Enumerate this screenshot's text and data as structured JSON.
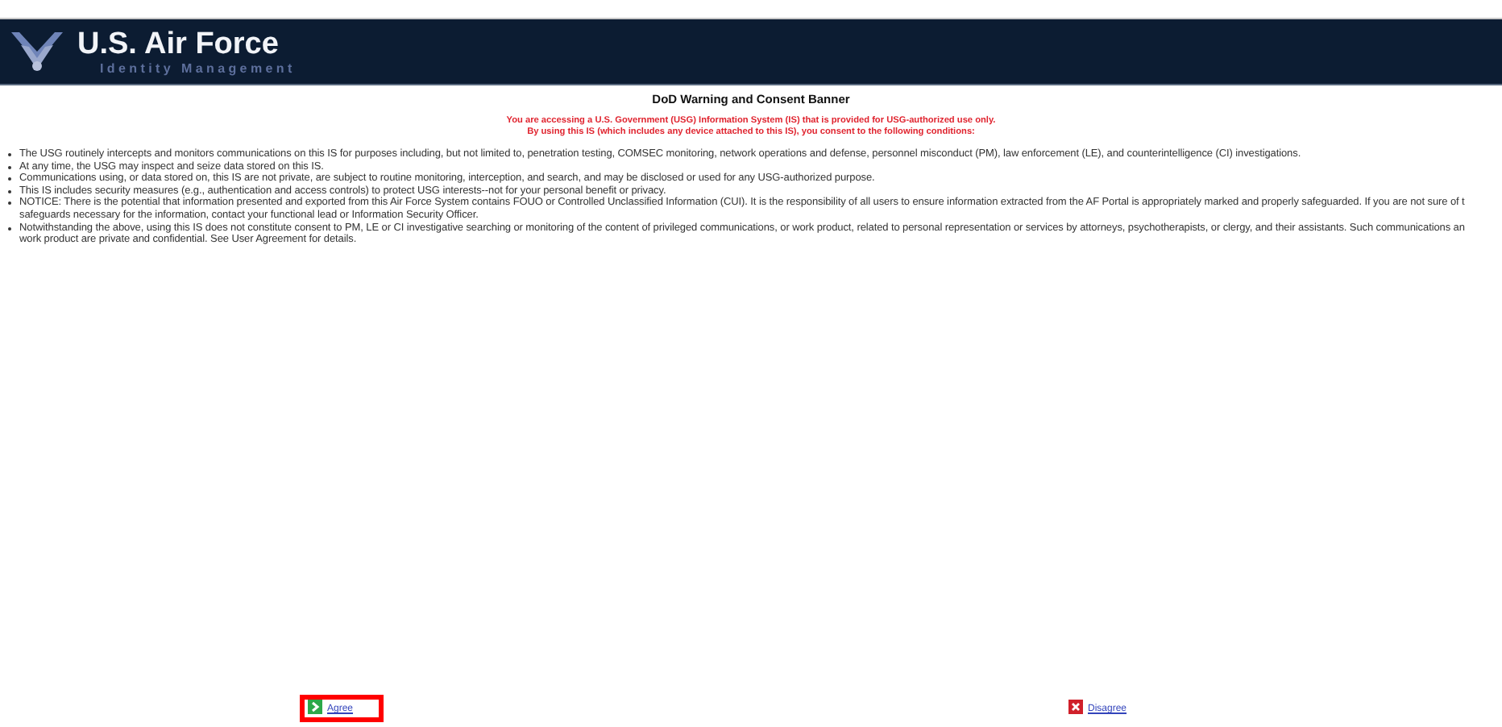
{
  "header": {
    "title": "U.S. Air Force",
    "subtitle": "Identity Management"
  },
  "banner": {
    "title": "DoD Warning and Consent Banner",
    "warning_lines": [
      "You are accessing a U.S. Government (USG) Information System (IS) that is provided for USG-authorized use only.",
      "By using this IS (which includes any device attached to this IS), you consent to the following conditions:"
    ],
    "conditions": [
      {
        "lines": [
          "The USG routinely intercepts and monitors communications on this IS for purposes including, but not limited to, penetration testing, COMSEC monitoring, network operations and defense, personnel misconduct (PM), law enforcement (LE), and counterintelligence (CI) investigations."
        ]
      },
      {
        "lines": [
          "At any time, the USG may inspect and seize data stored on this IS."
        ]
      },
      {
        "lines": [
          "Communications using, or data stored on, this IS are not private, are subject to routine monitoring, interception, and search, and may be disclosed or used for any USG-authorized purpose."
        ]
      },
      {
        "lines": [
          "This IS includes security measures (e.g., authentication and access controls) to protect USG interests--not for your personal benefit or privacy."
        ]
      },
      {
        "lines": [
          "NOTICE: There is the potential that information presented and exported from this Air Force System contains FOUO or Controlled Unclassified Information (CUI). It is the responsibility of all users to ensure information extracted from the AF Portal is appropriately marked and properly safeguarded. If you are not sure of t",
          "safeguards necessary for the information, contact your functional lead or Information Security Officer."
        ]
      },
      {
        "lines": [
          "Notwithstanding the above, using this IS does not constitute consent to PM, LE or CI investigative searching or monitoring of the content of privileged communications, or work product, related to personal representation or services by attorneys, psychotherapists, or clergy, and their assistants. Such communications an",
          "work product are private and confidential. See User Agreement for details."
        ]
      }
    ]
  },
  "actions": [
    {
      "kind": "agree",
      "label": "Agree",
      "highlighted": true
    },
    {
      "kind": "disagree",
      "label": "Disagree",
      "highlighted": false
    }
  ]
}
